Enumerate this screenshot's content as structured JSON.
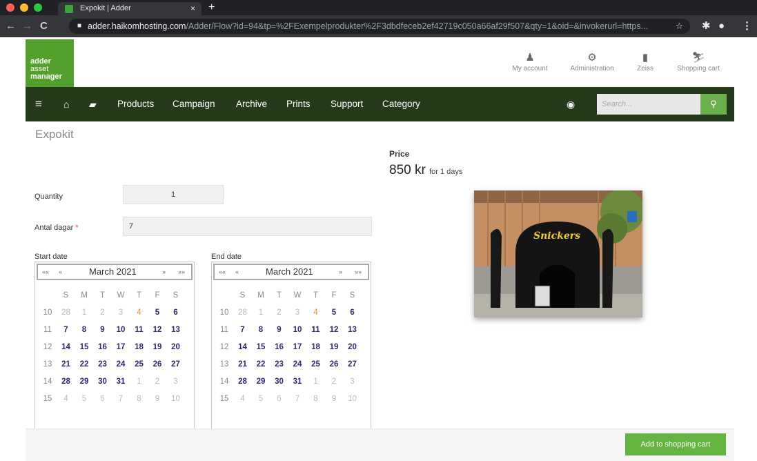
{
  "browser": {
    "tab_title": "Expokit | Adder",
    "tab_close": "×",
    "new_tab": "+",
    "url_host": "adder.haikomhosting.com",
    "url_path": "/Adder/Flow?id=94&tp=%2FExempelprodukter%2F3dbdfeceb2ef42719c050a66af29f507&qty=1&oid=&invokerurl=https..."
  },
  "header": {
    "logo": [
      "adder",
      "asset",
      "manager"
    ],
    "nav": [
      {
        "label": "My account",
        "icon": "user-icon"
      },
      {
        "label": "Administration",
        "icon": "cogs-icon"
      },
      {
        "label": "Zeiss",
        "icon": "building-icon"
      },
      {
        "label": "Shopping cart",
        "icon": "cart-icon"
      }
    ]
  },
  "menu": {
    "items": [
      "Products",
      "Campaign",
      "Archive",
      "Prints",
      "Support",
      "Category"
    ],
    "search_placeholder": "Search..."
  },
  "product": {
    "title": "Expokit",
    "price_label": "Price",
    "price": "850 kr",
    "price_suffix": "for 1 days",
    "image_label": "Snickers"
  },
  "form": {
    "quantity_label": "Quantity",
    "quantity_value": "1",
    "days_label": "Antal dagar",
    "required_marker": "*",
    "days_value": "7",
    "start_label": "Start date",
    "end_label": "End date"
  },
  "calendar": {
    "month": "March 2021",
    "nav": [
      "««",
      "«",
      "»",
      "»»"
    ],
    "weekdays": [
      "S",
      "M",
      "T",
      "W",
      "T",
      "F",
      "S"
    ],
    "weeks": [
      {
        "wk": "10",
        "days": [
          "28",
          "1",
          "2",
          "3",
          "4",
          "5",
          "6"
        ]
      },
      {
        "wk": "11",
        "days": [
          "7",
          "8",
          "9",
          "10",
          "11",
          "12",
          "13"
        ]
      },
      {
        "wk": "12",
        "days": [
          "14",
          "15",
          "16",
          "17",
          "18",
          "19",
          "20"
        ]
      },
      {
        "wk": "13",
        "days": [
          "21",
          "22",
          "23",
          "24",
          "25",
          "26",
          "27"
        ]
      },
      {
        "wk": "14",
        "days": [
          "28",
          "29",
          "30",
          "31",
          "1",
          "2",
          "3"
        ]
      },
      {
        "wk": "15",
        "days": [
          "4",
          "5",
          "6",
          "7",
          "8",
          "9",
          "10"
        ]
      }
    ],
    "colors": {
      "active": "#2c2a73",
      "today": "#e0921e",
      "muted": "#bbbbbb"
    }
  },
  "footer": {
    "add_to_cart": "Add to shopping cart"
  },
  "colors": {
    "brand_green": "#54a02c",
    "menu_bg": "#253a1a",
    "button_green": "#65b441"
  }
}
